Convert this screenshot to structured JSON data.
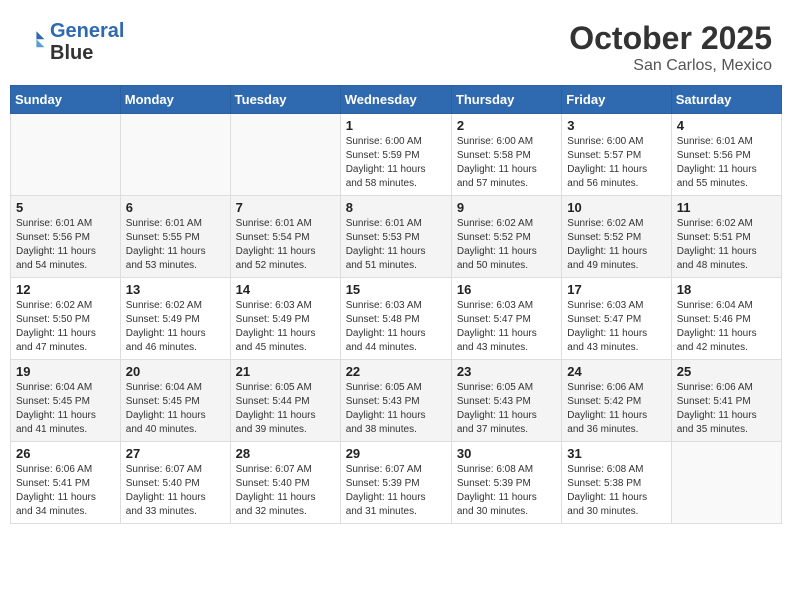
{
  "header": {
    "logo_line1": "General",
    "logo_line2": "Blue",
    "month": "October 2025",
    "location": "San Carlos, Mexico"
  },
  "weekdays": [
    "Sunday",
    "Monday",
    "Tuesday",
    "Wednesday",
    "Thursday",
    "Friday",
    "Saturday"
  ],
  "weeks": [
    [
      {
        "day": "",
        "info": ""
      },
      {
        "day": "",
        "info": ""
      },
      {
        "day": "",
        "info": ""
      },
      {
        "day": "1",
        "info": "Sunrise: 6:00 AM\nSunset: 5:59 PM\nDaylight: 11 hours\nand 58 minutes."
      },
      {
        "day": "2",
        "info": "Sunrise: 6:00 AM\nSunset: 5:58 PM\nDaylight: 11 hours\nand 57 minutes."
      },
      {
        "day": "3",
        "info": "Sunrise: 6:00 AM\nSunset: 5:57 PM\nDaylight: 11 hours\nand 56 minutes."
      },
      {
        "day": "4",
        "info": "Sunrise: 6:01 AM\nSunset: 5:56 PM\nDaylight: 11 hours\nand 55 minutes."
      }
    ],
    [
      {
        "day": "5",
        "info": "Sunrise: 6:01 AM\nSunset: 5:56 PM\nDaylight: 11 hours\nand 54 minutes."
      },
      {
        "day": "6",
        "info": "Sunrise: 6:01 AM\nSunset: 5:55 PM\nDaylight: 11 hours\nand 53 minutes."
      },
      {
        "day": "7",
        "info": "Sunrise: 6:01 AM\nSunset: 5:54 PM\nDaylight: 11 hours\nand 52 minutes."
      },
      {
        "day": "8",
        "info": "Sunrise: 6:01 AM\nSunset: 5:53 PM\nDaylight: 11 hours\nand 51 minutes."
      },
      {
        "day": "9",
        "info": "Sunrise: 6:02 AM\nSunset: 5:52 PM\nDaylight: 11 hours\nand 50 minutes."
      },
      {
        "day": "10",
        "info": "Sunrise: 6:02 AM\nSunset: 5:52 PM\nDaylight: 11 hours\nand 49 minutes."
      },
      {
        "day": "11",
        "info": "Sunrise: 6:02 AM\nSunset: 5:51 PM\nDaylight: 11 hours\nand 48 minutes."
      }
    ],
    [
      {
        "day": "12",
        "info": "Sunrise: 6:02 AM\nSunset: 5:50 PM\nDaylight: 11 hours\nand 47 minutes."
      },
      {
        "day": "13",
        "info": "Sunrise: 6:02 AM\nSunset: 5:49 PM\nDaylight: 11 hours\nand 46 minutes."
      },
      {
        "day": "14",
        "info": "Sunrise: 6:03 AM\nSunset: 5:49 PM\nDaylight: 11 hours\nand 45 minutes."
      },
      {
        "day": "15",
        "info": "Sunrise: 6:03 AM\nSunset: 5:48 PM\nDaylight: 11 hours\nand 44 minutes."
      },
      {
        "day": "16",
        "info": "Sunrise: 6:03 AM\nSunset: 5:47 PM\nDaylight: 11 hours\nand 43 minutes."
      },
      {
        "day": "17",
        "info": "Sunrise: 6:03 AM\nSunset: 5:47 PM\nDaylight: 11 hours\nand 43 minutes."
      },
      {
        "day": "18",
        "info": "Sunrise: 6:04 AM\nSunset: 5:46 PM\nDaylight: 11 hours\nand 42 minutes."
      }
    ],
    [
      {
        "day": "19",
        "info": "Sunrise: 6:04 AM\nSunset: 5:45 PM\nDaylight: 11 hours\nand 41 minutes."
      },
      {
        "day": "20",
        "info": "Sunrise: 6:04 AM\nSunset: 5:45 PM\nDaylight: 11 hours\nand 40 minutes."
      },
      {
        "day": "21",
        "info": "Sunrise: 6:05 AM\nSunset: 5:44 PM\nDaylight: 11 hours\nand 39 minutes."
      },
      {
        "day": "22",
        "info": "Sunrise: 6:05 AM\nSunset: 5:43 PM\nDaylight: 11 hours\nand 38 minutes."
      },
      {
        "day": "23",
        "info": "Sunrise: 6:05 AM\nSunset: 5:43 PM\nDaylight: 11 hours\nand 37 minutes."
      },
      {
        "day": "24",
        "info": "Sunrise: 6:06 AM\nSunset: 5:42 PM\nDaylight: 11 hours\nand 36 minutes."
      },
      {
        "day": "25",
        "info": "Sunrise: 6:06 AM\nSunset: 5:41 PM\nDaylight: 11 hours\nand 35 minutes."
      }
    ],
    [
      {
        "day": "26",
        "info": "Sunrise: 6:06 AM\nSunset: 5:41 PM\nDaylight: 11 hours\nand 34 minutes."
      },
      {
        "day": "27",
        "info": "Sunrise: 6:07 AM\nSunset: 5:40 PM\nDaylight: 11 hours\nand 33 minutes."
      },
      {
        "day": "28",
        "info": "Sunrise: 6:07 AM\nSunset: 5:40 PM\nDaylight: 11 hours\nand 32 minutes."
      },
      {
        "day": "29",
        "info": "Sunrise: 6:07 AM\nSunset: 5:39 PM\nDaylight: 11 hours\nand 31 minutes."
      },
      {
        "day": "30",
        "info": "Sunrise: 6:08 AM\nSunset: 5:39 PM\nDaylight: 11 hours\nand 30 minutes."
      },
      {
        "day": "31",
        "info": "Sunrise: 6:08 AM\nSunset: 5:38 PM\nDaylight: 11 hours\nand 30 minutes."
      },
      {
        "day": "",
        "info": ""
      }
    ]
  ]
}
